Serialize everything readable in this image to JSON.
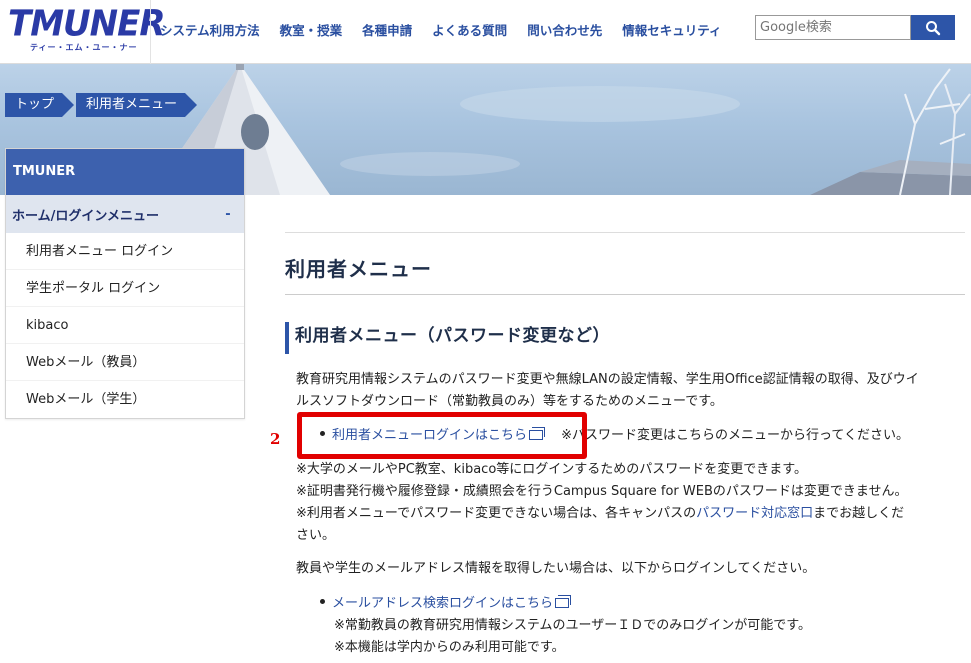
{
  "header": {
    "logo_main": "TMUNER",
    "logo_sub": "ティー・エム・ユー・ナー",
    "nav": [
      "システム利用方法",
      "教室・授業",
      "各種申請",
      "よくある質問",
      "問い合わせ先",
      "情報セキュリティ"
    ],
    "search_placeholder": "Google検索"
  },
  "breadcrumb": [
    "トップ",
    "利用者メニュー"
  ],
  "sidebar": {
    "title": "TMUNER",
    "section_label": "ホーム/ログインメニュー",
    "section_toggle": "-",
    "items": [
      "利用者メニュー ログイン",
      "学生ポータル ログイン",
      "kibaco",
      "Webメール（教員）",
      "Webメール（学生）"
    ]
  },
  "main": {
    "page_title": "利用者メニュー",
    "section_title": "利用者メニュー（パスワード変更など）",
    "intro_line1": "教育研究用情報システムのパスワード変更や無線LANの設定情報、学生用Office認証情報の取得、及びウイ",
    "intro_line2": "ルスソフトダウンロード（常勤教員のみ）等をするためのメニューです。",
    "login_link": "利用者メニューログインはこちら",
    "login_note": "※パスワード変更はこちらのメニューから行ってください。",
    "note1": "※大学のメールやPC教室、kibaco等にログインするためのパスワードを変更できます。",
    "note2": "※証明書発行機や履修登録・成績照会を行うCampus Square for WEBのパスワードは変更できません。",
    "note3_pre": "※利用者メニューでパスワード変更できない場合は、各キャンパスの",
    "note3_link": "パスワード対応窓口",
    "note3_post": "までお越しくだ",
    "note3_line2": "さい。",
    "mail_intro": "教員や学生のメールアドレス情報を取得したい場合は、以下からログインしてください。",
    "mail_link": "メールアドレス検索ログインはこちら",
    "mail_note1": "※常勤教員の教育研究用情報システムのユーザーＩＤでのみログインが可能です。",
    "mail_note2": "※本機能は学内からのみ利用可能です。"
  },
  "annotation": {
    "step_number": "2",
    "color": "#e10000"
  },
  "colors": {
    "brand": "#2a3aa6",
    "accent": "#2d55a8",
    "link": "#2a4fa0"
  }
}
